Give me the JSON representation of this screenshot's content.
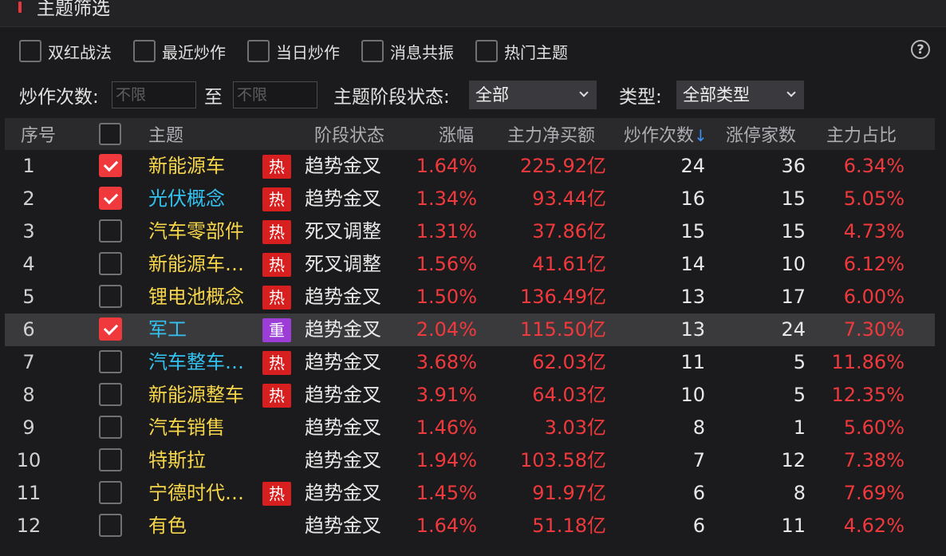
{
  "window": {
    "title": "主题筛选"
  },
  "filters": [
    {
      "label": "双红战法",
      "checked": false
    },
    {
      "label": "最近炒作",
      "checked": false
    },
    {
      "label": "当日炒作",
      "checked": false
    },
    {
      "label": "消息共振",
      "checked": false
    },
    {
      "label": "热门主题",
      "checked": false
    }
  ],
  "help": {
    "symbol": "?"
  },
  "params": {
    "count_label": "炒作次数:",
    "from_placeholder": "不限",
    "to_label": "至",
    "to_placeholder": "不限",
    "stage_label": "主题阶段状态:",
    "stage_value": "全部",
    "type_label": "类型:",
    "type_value": "全部类型"
  },
  "table": {
    "headers": {
      "index": "序号",
      "theme": "主题",
      "stage": "阶段状态",
      "change": "涨幅",
      "net_buy": "主力净买额",
      "count": "炒作次数",
      "sort_indicator": "↓",
      "limit_up": "涨停家数",
      "ratio": "主力占比"
    },
    "rows": [
      {
        "index": "1",
        "checked": true,
        "name": "新能源车",
        "name_color": "yellow",
        "tag": "热",
        "stage": "趋势金叉",
        "change": "1.64%",
        "net_buy": "225.92亿",
        "count": "24",
        "limit_up": "36",
        "ratio": "6.34%"
      },
      {
        "index": "2",
        "checked": true,
        "name": "光伏概念",
        "name_color": "cyan",
        "tag": "热",
        "stage": "趋势金叉",
        "change": "1.34%",
        "net_buy": "93.44亿",
        "count": "16",
        "limit_up": "15",
        "ratio": "5.05%"
      },
      {
        "index": "3",
        "checked": false,
        "name": "汽车零部件",
        "name_color": "yellow",
        "tag": "热",
        "stage": "死叉调整",
        "change": "1.31%",
        "net_buy": "37.86亿",
        "count": "15",
        "limit_up": "15",
        "ratio": "4.73%"
      },
      {
        "index": "4",
        "checked": false,
        "name": "新能源车…",
        "name_color": "yellow",
        "tag": "热",
        "stage": "死叉调整",
        "change": "1.56%",
        "net_buy": "41.61亿",
        "count": "14",
        "limit_up": "10",
        "ratio": "6.12%"
      },
      {
        "index": "5",
        "checked": false,
        "name": "锂电池概念",
        "name_color": "yellow",
        "tag": "热",
        "stage": "趋势金叉",
        "change": "1.50%",
        "net_buy": "136.49亿",
        "count": "13",
        "limit_up": "17",
        "ratio": "6.00%"
      },
      {
        "index": "6",
        "checked": true,
        "name": "军工",
        "name_color": "cyan",
        "tag": "重",
        "stage": "趋势金叉",
        "change": "2.04%",
        "net_buy": "115.50亿",
        "count": "13",
        "limit_up": "24",
        "ratio": "7.30%",
        "selected": true
      },
      {
        "index": "7",
        "checked": false,
        "name": "汽车整车…",
        "name_color": "cyan",
        "tag": "热",
        "stage": "趋势金叉",
        "change": "3.68%",
        "net_buy": "62.03亿",
        "count": "11",
        "limit_up": "5",
        "ratio": "11.86%"
      },
      {
        "index": "8",
        "checked": false,
        "name": "新能源整车",
        "name_color": "yellow",
        "tag": "热",
        "stage": "趋势金叉",
        "change": "3.91%",
        "net_buy": "64.03亿",
        "count": "10",
        "limit_up": "5",
        "ratio": "12.35%"
      },
      {
        "index": "9",
        "checked": false,
        "name": "汽车销售",
        "name_color": "yellow",
        "tag": "",
        "stage": "趋势金叉",
        "change": "1.46%",
        "net_buy": "3.03亿",
        "count": "8",
        "limit_up": "1",
        "ratio": "5.60%"
      },
      {
        "index": "10",
        "checked": false,
        "name": "特斯拉",
        "name_color": "yellow",
        "tag": "",
        "stage": "趋势金叉",
        "change": "1.94%",
        "net_buy": "103.58亿",
        "count": "7",
        "limit_up": "12",
        "ratio": "7.38%"
      },
      {
        "index": "11",
        "checked": false,
        "name": "宁德时代…",
        "name_color": "yellow",
        "tag": "热",
        "stage": "趋势金叉",
        "change": "1.45%",
        "net_buy": "91.97亿",
        "count": "6",
        "limit_up": "8",
        "ratio": "7.69%"
      },
      {
        "index": "12",
        "checked": false,
        "name": "有色",
        "name_color": "yellow",
        "tag": "",
        "stage": "趋势金叉",
        "change": "1.64%",
        "net_buy": "51.18亿",
        "count": "6",
        "limit_up": "11",
        "ratio": "4.62%"
      }
    ]
  },
  "colors": {
    "up_red": "#f0393c",
    "name_yellow": "#f5d54a",
    "name_cyan": "#33c2f0",
    "tag_hot": "#d81f1f",
    "tag_key": "#9b3dd6",
    "sort_blue": "#3a8ff0"
  }
}
